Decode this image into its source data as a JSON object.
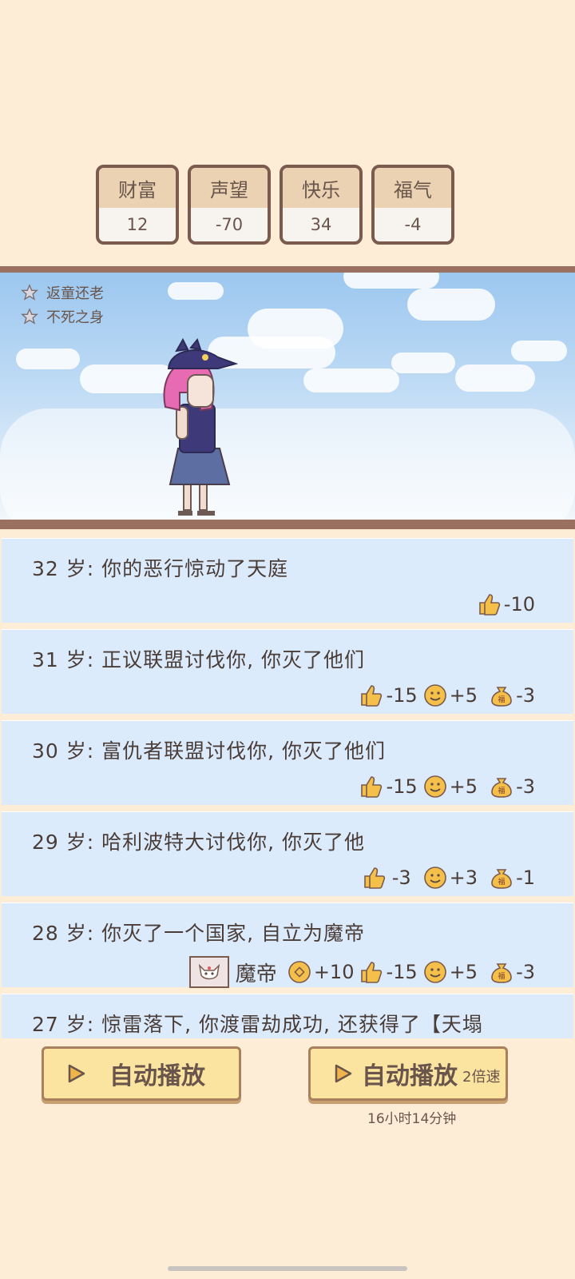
{
  "stats": [
    {
      "label": "财富",
      "value": "12"
    },
    {
      "label": "声望",
      "value": "-70"
    },
    {
      "label": "快乐",
      "value": "34"
    },
    {
      "label": "福气",
      "value": "-4"
    }
  ],
  "buffs": [
    "返童还老",
    "不死之身"
  ],
  "log": [
    {
      "text": "32 岁: 你的恶行惊动了天庭",
      "effects": [
        {
          "icon": "thumbs-up-icon",
          "value": "-10"
        }
      ]
    },
    {
      "text": "31 岁: 正议联盟讨伐你, 你灭了他们",
      "effects": [
        {
          "icon": "thumbs-up-icon",
          "value": "-15"
        },
        {
          "icon": "smile-icon",
          "value": "+5"
        },
        {
          "icon": "fortune-bag-icon",
          "value": "-3"
        }
      ]
    },
    {
      "text": "30 岁: 富仇者联盟讨伐你, 你灭了他们",
      "effects": [
        {
          "icon": "thumbs-up-icon",
          "value": "-15"
        },
        {
          "icon": "smile-icon",
          "value": "+5"
        },
        {
          "icon": "fortune-bag-icon",
          "value": "-3"
        }
      ]
    },
    {
      "text": "29 岁: 哈利波特大讨伐你, 你灭了他",
      "effects": [
        {
          "icon": "thumbs-up-icon",
          "value": "-3"
        },
        {
          "icon": "smile-icon",
          "value": "+3"
        },
        {
          "icon": "fortune-bag-icon",
          "value": "-1"
        }
      ]
    },
    {
      "text": "28 岁: 你灭了一个国家, 自立为魔帝",
      "title": "魔帝",
      "effects": [
        {
          "icon": "coin-icon",
          "value": "+10"
        },
        {
          "icon": "thumbs-up-icon",
          "value": "-15"
        },
        {
          "icon": "smile-icon",
          "value": "+5"
        },
        {
          "icon": "fortune-bag-icon",
          "value": "-3"
        }
      ]
    },
    {
      "text": "27 岁: 惊雷落下, 你渡雷劫成功, 还获得了【天塌",
      "effects": []
    }
  ],
  "buttons": {
    "auto_play": "自动播放",
    "auto_play_fast": "自动播放",
    "speed": "2倍速",
    "timer": "16小时14分钟"
  },
  "colors": {
    "background": "#fdecd6",
    "card_border": "#7a5b4e",
    "log_bg": "#dcebfc",
    "button_bg": "#fbe3a0"
  }
}
